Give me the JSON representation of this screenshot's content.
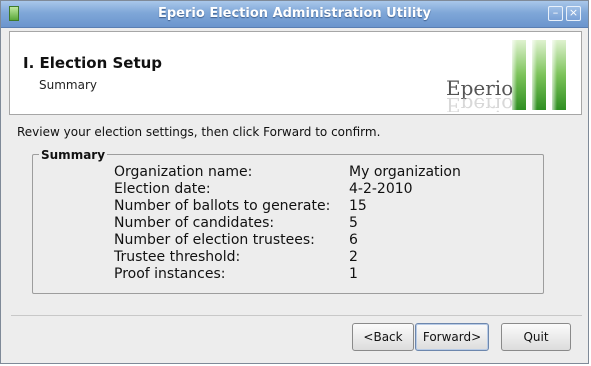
{
  "window": {
    "title": "Eperio Election Administration Utility",
    "minimize_glyph": "–",
    "close_glyph": "×",
    "app_icon": "app-icon"
  },
  "header": {
    "step_title": "I. Election Setup",
    "step_subtitle": "Summary",
    "brand": "Eperio",
    "brand_reflection": "Eperio",
    "logo_colors": [
      "#3aa12a",
      "#9ad17a",
      "#dff2cf"
    ]
  },
  "content": {
    "instruction": "Review your election settings, then click Forward to confirm.",
    "group_label": "Summary",
    "rows": [
      {
        "label": "Organization name:",
        "value": "My organization"
      },
      {
        "label": "Election date:",
        "value": "4-2-2010"
      },
      {
        "label": "Number of ballots to generate:",
        "value": "15"
      },
      {
        "label": "Number of candidates:",
        "value": "5"
      },
      {
        "label": "Number of election trustees:",
        "value": "6"
      },
      {
        "label": "Trustee threshold:",
        "value": "2"
      },
      {
        "label": "Proof instances:",
        "value": "1"
      }
    ]
  },
  "buttons": {
    "back": "<Back",
    "forward": "Forward>",
    "quit": "Quit"
  }
}
